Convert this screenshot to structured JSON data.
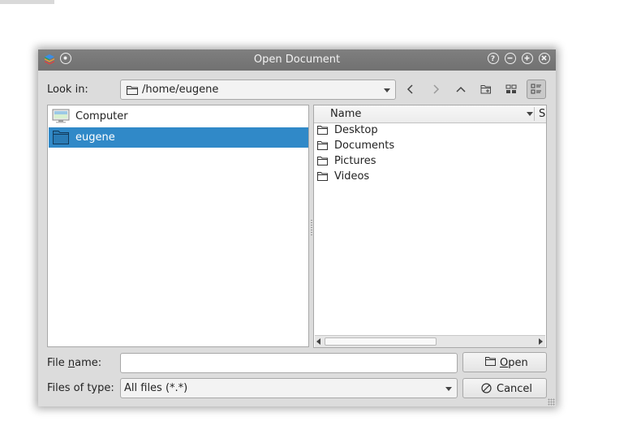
{
  "window": {
    "title": "Open Document",
    "controls": [
      "help-icon",
      "minimize-icon",
      "maximize-icon",
      "close-icon"
    ]
  },
  "look_in": {
    "label": "Look in:",
    "path": "/home/eugene"
  },
  "toolbar": [
    "back-icon",
    "forward-icon",
    "parent-dir-icon",
    "new-folder-icon",
    "icon-view-icon",
    "detail-view-icon"
  ],
  "sidebar": {
    "items": [
      {
        "label": "Computer",
        "icon": "computer-icon",
        "selected": false
      },
      {
        "label": "eugene",
        "icon": "folder-icon",
        "selected": true
      }
    ]
  },
  "file_list": {
    "columns": [
      {
        "label": "Name"
      },
      {
        "label": "S"
      }
    ],
    "rows": [
      {
        "name": "Desktop",
        "icon": "folder-icon"
      },
      {
        "name": "Documents",
        "icon": "folder-icon"
      },
      {
        "name": "Pictures",
        "icon": "folder-icon"
      },
      {
        "name": "Videos",
        "icon": "folder-icon"
      }
    ]
  },
  "filename": {
    "label_pre": "File ",
    "label_u": "n",
    "label_post": "ame:",
    "value": "",
    "placeholder": ""
  },
  "filetype": {
    "label": "Files of type:",
    "value": "All files (*.*)"
  },
  "buttons": {
    "open_u": "O",
    "open_rest": "pen",
    "cancel": "Cancel"
  },
  "colors": {
    "selection": "#3089c8",
    "titlebar": "#777777",
    "dialog_bg": "#dcdcdc"
  }
}
